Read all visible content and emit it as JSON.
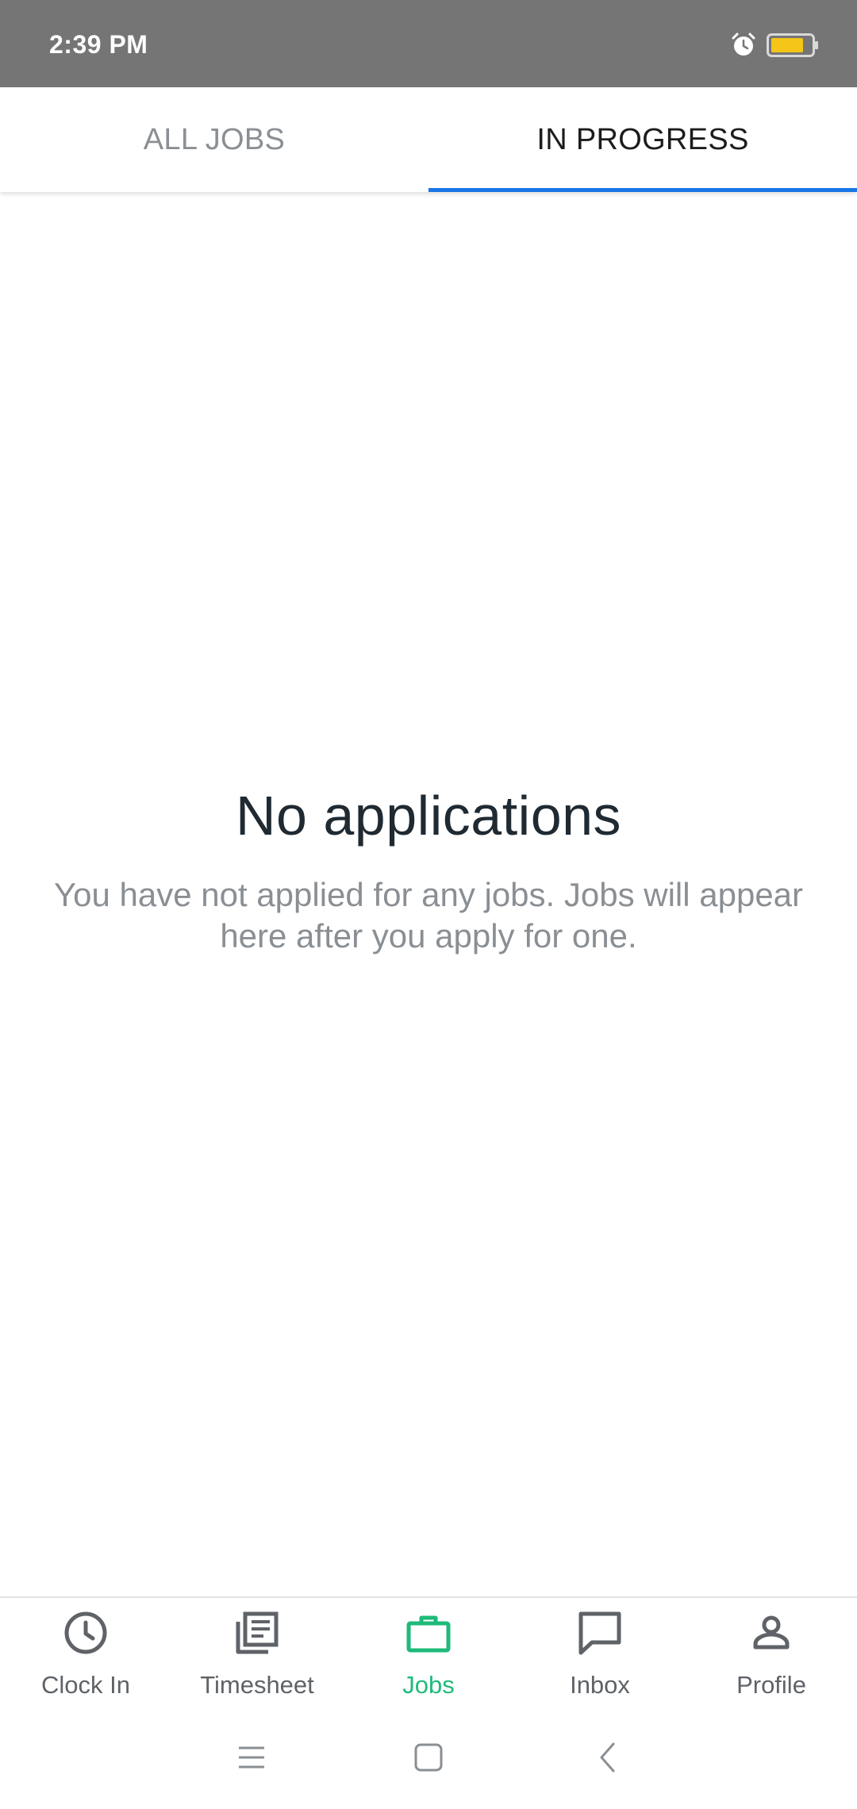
{
  "status_bar": {
    "time": "2:39 PM",
    "icons": [
      "alarm-icon",
      "battery-icon"
    ],
    "battery_color": "#f5c518"
  },
  "tabs": [
    {
      "label": "ALL JOBS",
      "active": false
    },
    {
      "label": "IN PROGRESS",
      "active": true
    }
  ],
  "empty_state": {
    "title": "No applications",
    "description": "You have not applied for any jobs. Jobs will appear here after you apply for one."
  },
  "bottom_nav": {
    "items": [
      {
        "label": "Clock In",
        "icon": "clock-icon",
        "active": false
      },
      {
        "label": "Timesheet",
        "icon": "timesheet-icon",
        "active": false
      },
      {
        "label": "Jobs",
        "icon": "briefcase-icon",
        "active": true
      },
      {
        "label": "Inbox",
        "icon": "chat-icon",
        "active": false
      },
      {
        "label": "Profile",
        "icon": "person-icon",
        "active": false
      }
    ]
  },
  "system_nav": {
    "icons": [
      "menu-icon",
      "home-icon",
      "back-icon"
    ]
  },
  "colors": {
    "accent_blue": "#1976e6",
    "active_green": "#1fba7a",
    "status_bar": "#757575"
  }
}
